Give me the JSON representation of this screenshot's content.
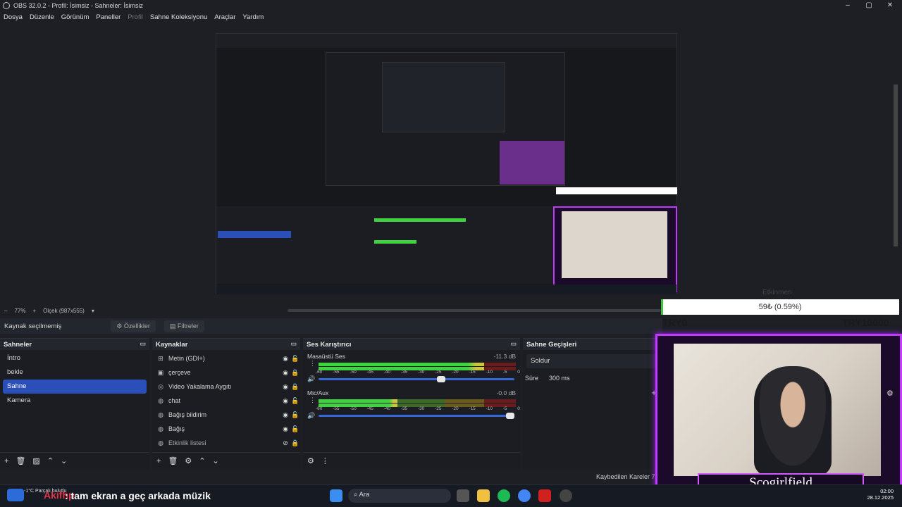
{
  "window": {
    "title": "OBS 32.0.2 - Profil: İsimsiz - Sahneler: İsimsiz",
    "controls": {
      "minimize": "–",
      "maximize": "▢",
      "close": "✕"
    }
  },
  "menu": [
    "Dosya",
    "Düzenle",
    "Görünüm",
    "Paneller",
    "Profil",
    "Sahne Koleksiyonu",
    "Araçlar",
    "Yardım"
  ],
  "zoom": {
    "level": "77%",
    "scale_label": "Ölçek (987x555)"
  },
  "context": {
    "no_source": "Kaynak seçilmemiş",
    "properties": "Özellikler",
    "filters": "Filtreler"
  },
  "scenes": {
    "title": "Sahneler",
    "items": [
      "İntro",
      "bekle",
      "Sahne",
      "Kamera"
    ],
    "selected": "Sahne"
  },
  "sources": {
    "title": "Kaynaklar",
    "items": [
      {
        "name": "Metin (GDI+)",
        "icon": "text-icon"
      },
      {
        "name": "çerçeve",
        "icon": "image-icon"
      },
      {
        "name": "Video Yakalama Aygıtı",
        "icon": "camera-icon"
      },
      {
        "name": "chat",
        "icon": "browser-icon"
      },
      {
        "name": "Bağış bildirim",
        "icon": "browser-icon"
      },
      {
        "name": "Bağış",
        "icon": "browser-icon"
      },
      {
        "name": "Etkinlik listesi",
        "icon": "browser-icon"
      }
    ]
  },
  "mixer": {
    "title": "Ses Karıştırıcı",
    "channels": [
      {
        "name": "Masaüstü Ses",
        "db": "-11.3 dB",
        "level": 0.84,
        "volume": 0.63
      },
      {
        "name": "Mic/Aux",
        "db": "-0.0 dB",
        "level": 0.4,
        "volume": 1.0
      }
    ],
    "ticks": [
      "-60",
      "-55",
      "-50",
      "-45",
      "-40",
      "-35",
      "-30",
      "-25",
      "-20",
      "-15",
      "-10",
      "-5",
      "0"
    ]
  },
  "transitions": {
    "title": "Sahne Geçişleri",
    "type": "Soldur",
    "duration_label": "Süre",
    "duration_value": "300 ms"
  },
  "status": {
    "dropped_frames": "Kaybedilen Kareler 7"
  },
  "overlay": {
    "goal_title": "Etkinmen",
    "goal_text": "59₺ (0.59%)",
    "goal_progress": 0.0059,
    "goal_min": "TRY0",
    "goal_max": "TRY10000",
    "name": "Scogirlfield"
  },
  "ticker": {
    "user": "Akifhp",
    "small_text": "-1°C Parçalı bulutlu",
    "message": ": tam ekran a geç arkada müzik"
  },
  "taskbar": {
    "search_placeholder": "Ara",
    "time": "02:00",
    "date": "28.12.2025"
  },
  "colors": {
    "accent": "#2a4fb8",
    "overlay_frame": "#c338ff",
    "meter_green": "#3fd23f"
  }
}
